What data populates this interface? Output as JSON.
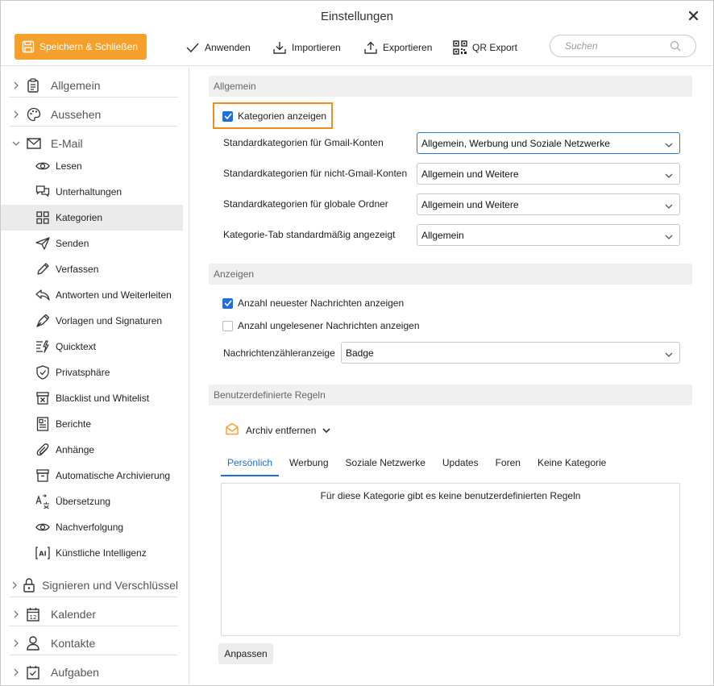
{
  "window": {
    "title": "Einstellungen"
  },
  "toolbar": {
    "save_close": "Speichern & Schließen",
    "apply": "Anwenden",
    "import": "Importieren",
    "export": "Exportieren",
    "qr_export": "QR Export",
    "search_placeholder": "Suchen"
  },
  "sidebar": {
    "groups_top": [
      {
        "label": "Allgemein",
        "icon": "clipboard-icon"
      },
      {
        "label": "Aussehen",
        "icon": "palette-icon"
      },
      {
        "label": "E-Mail",
        "icon": "envelope-icon",
        "expanded": true
      }
    ],
    "email_items": [
      {
        "label": "Lesen",
        "icon": "eye-icon"
      },
      {
        "label": "Unterhaltungen",
        "icon": "conversation-icon"
      },
      {
        "label": "Kategorien",
        "icon": "grid-icon",
        "active": true
      },
      {
        "label": "Senden",
        "icon": "send-icon"
      },
      {
        "label": "Verfassen",
        "icon": "pencil-icon"
      },
      {
        "label": "Antworten und Weiterleiten",
        "icon": "reply-icon"
      },
      {
        "label": "Vorlagen und Signaturen",
        "icon": "pen-nib-icon"
      },
      {
        "label": "Quicktext",
        "icon": "quicktext-icon"
      },
      {
        "label": "Privatsphäre",
        "icon": "shield-icon"
      },
      {
        "label": "Blacklist und Whitelist",
        "icon": "blacklist-icon"
      },
      {
        "label": "Berichte",
        "icon": "report-icon"
      },
      {
        "label": "Anhänge",
        "icon": "paperclip-icon"
      },
      {
        "label": "Automatische Archivierung",
        "icon": "archive-icon"
      },
      {
        "label": "Übersetzung",
        "icon": "translate-icon"
      },
      {
        "label": "Nachverfolgung",
        "icon": "eye-icon"
      },
      {
        "label": "Künstliche Intelligenz",
        "icon": "ai-icon"
      }
    ],
    "groups_bottom": [
      {
        "label": "Signieren und Verschlüssel",
        "icon": "lock-icon"
      },
      {
        "label": "Kalender",
        "icon": "calendar-icon"
      },
      {
        "label": "Kontakte",
        "icon": "person-icon"
      },
      {
        "label": "Aufgaben",
        "icon": "task-icon"
      }
    ]
  },
  "main": {
    "section_general": "Allgemein",
    "show_categories": {
      "label": "Kategorien anzeigen",
      "checked": true
    },
    "rows": [
      {
        "label": "Standardkategorien für Gmail-Konten",
        "value": "Allgemein, Werbung und Soziale Netzwerke"
      },
      {
        "label": "Standardkategorien für nicht-Gmail-Konten",
        "value": "Allgemein und Weitere"
      },
      {
        "label": "Standardkategorien für globale Ordner",
        "value": "Allgemein und Weitere"
      },
      {
        "label": "Kategorie-Tab standardmäßig angezeigt",
        "value": "Allgemein"
      }
    ],
    "section_display": "Anzeigen",
    "show_newest_count": {
      "label": "Anzahl neuester Nachrichten anzeigen",
      "checked": true
    },
    "show_unread_count": {
      "label": "Anzahl ungelesener Nachrichten anzeigen",
      "checked": false
    },
    "counter_display": {
      "label": "Nachrichtenzähleranzeige",
      "value": "Badge"
    },
    "section_rules": "Benutzerdefinierte Regeln",
    "archive_action": "Archiv entfernen",
    "tabs": [
      "Persönlich",
      "Werbung",
      "Soziale Netzwerke",
      "Updates",
      "Foren",
      "Keine Kategorie"
    ],
    "rules_empty": "Für diese Kategorie gibt es keine benutzerdefinierten Regeln",
    "adjust_button": "Anpassen"
  },
  "colors": {
    "accent": "#f5a02a",
    "highlight": "#f28c1b",
    "checkbox": "#1e6fd9"
  }
}
